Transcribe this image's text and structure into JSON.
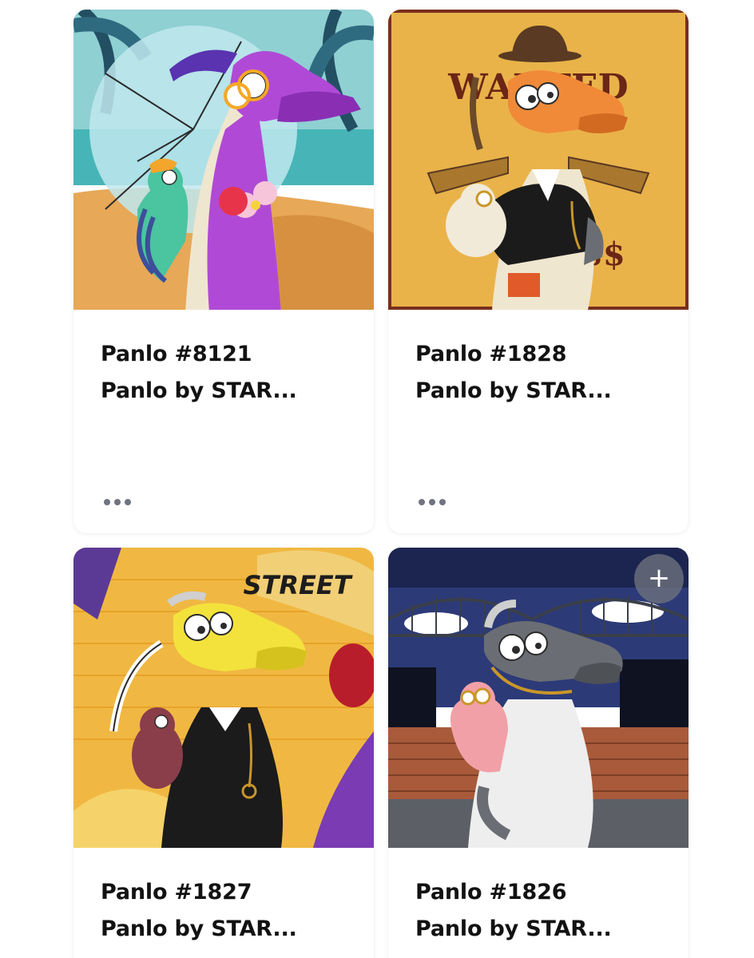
{
  "cards": [
    {
      "title": "Panlo #8121",
      "collection": "Panlo by STAR...",
      "more_icon": "ellipsis-icon",
      "art_theme": "beach",
      "colors": {
        "dragon": "#b04ad6",
        "bg_sky": "#8fd0d2",
        "bg_sand": "#e7a857"
      }
    },
    {
      "title": "Panlo #1828",
      "collection": "Panlo by STAR...",
      "more_icon": "ellipsis-icon",
      "art_theme": "wanted-poster",
      "art_text": {
        "wanted": "WANTED",
        "reward": "$$$"
      },
      "colors": {
        "dragon": "#f08a38",
        "bg": "#e9b34a"
      }
    },
    {
      "title": "Panlo #1827",
      "collection": "Panlo by STAR...",
      "art_theme": "graffiti-wall",
      "art_text": {
        "graffiti": "STREET"
      },
      "colors": {
        "dragon": "#f3e23c",
        "bg": "#f0b842"
      }
    },
    {
      "title": "Panlo #1826",
      "collection": "Panlo by STAR...",
      "art_theme": "city-bridge-night",
      "add_button": {
        "icon": "plus-icon",
        "label": "+"
      },
      "colors": {
        "dragon": "#6a6d73",
        "bg_sky": "#2c3a78",
        "bg_wall": "#a85a3a"
      }
    }
  ]
}
